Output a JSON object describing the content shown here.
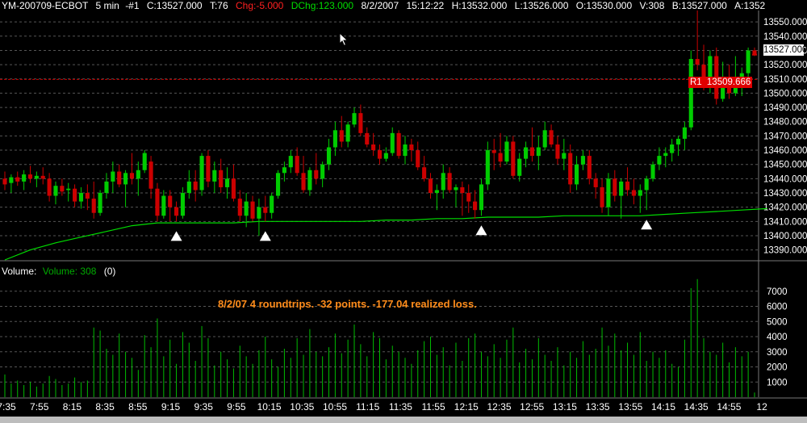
{
  "header": {
    "symbol": "YM-200709-ECBOT",
    "interval": "5 min",
    "instance": "-#1",
    "close": "C:13527.000",
    "ticks": "T:76",
    "chg": "Chg:-5.000",
    "dchg": "DChg:123.000",
    "date": "8/2/2007",
    "time": "15:12:22",
    "high": "H:13532.000",
    "low": "L:13526.000",
    "open": "O:13530.000",
    "volume": "V:308",
    "bid": "B:13527.000",
    "ask": "A:1352"
  },
  "volume_panel": {
    "label": "Volume:",
    "series_label": "Volume: 308",
    "count": "(0)"
  },
  "annotation": "8/2/07 4 roundtrips.  -32 points.  -177.04 realized loss.",
  "last_price_label": "13527.000",
  "r1_label": "R1",
  "r1_value": "13509.666",
  "colors": {
    "up": "#00cc00",
    "down": "#cc0000",
    "ma": "#00dd00",
    "grid": "#555555",
    "r1_line": "#cc0000",
    "text": "#ffffff",
    "annotation": "#ff8c1a"
  },
  "chart_data": {
    "type": "candlestick",
    "price_ticks": [
      13390,
      13400,
      13410,
      13420,
      13430,
      13440,
      13450,
      13460,
      13470,
      13480,
      13490,
      13500,
      13510,
      13520,
      13530,
      13540,
      13550
    ],
    "price_tick_labels": [
      "13390.000",
      "13400.000",
      "13410.000",
      "13420.000",
      "13430.000",
      "13440.000",
      "13450.000",
      "13460.000",
      "13470.000",
      "13480.000",
      "13490.000",
      "13500.000",
      "13510.000",
      "13520.000",
      "13530.000",
      "13540.000",
      "13550.000"
    ],
    "price_range": [
      13383,
      13558
    ],
    "volume_ticks": [
      1000,
      2000,
      3000,
      4000,
      5000,
      6000,
      7000
    ],
    "volume_tick_labels": [
      "1000",
      "2000",
      "3000",
      "4000",
      "5000",
      "6000",
      "7000"
    ],
    "volume_range": [
      0,
      8000
    ],
    "time_labels": [
      "7:35",
      "7:55",
      "8:15",
      "8:35",
      "8:55",
      "9:15",
      "9:35",
      "9:55",
      "10:15",
      "10:35",
      "10:55",
      "11:15",
      "11:35",
      "11:55",
      "12:15",
      "12:35",
      "12:55",
      "13:15",
      "13:35",
      "13:55",
      "14:15",
      "14:35",
      "14:55",
      "12"
    ],
    "r1_level": 13509.666,
    "moving_average": [
      [
        0,
        13383
      ],
      [
        4,
        13390
      ],
      [
        8,
        13395
      ],
      [
        12,
        13399
      ],
      [
        16,
        13403
      ],
      [
        20,
        13407
      ],
      [
        24,
        13409
      ],
      [
        28,
        13409
      ],
      [
        32,
        13409
      ],
      [
        36,
        13409
      ],
      [
        40,
        13410
      ],
      [
        44,
        13410
      ],
      [
        48,
        13410
      ],
      [
        52,
        13410
      ],
      [
        56,
        13410
      ],
      [
        60,
        13411
      ],
      [
        64,
        13411
      ],
      [
        68,
        13412
      ],
      [
        72,
        13412
      ],
      [
        76,
        13413
      ],
      [
        80,
        13413
      ],
      [
        84,
        13413
      ],
      [
        88,
        13414
      ],
      [
        92,
        13414
      ],
      [
        96,
        13414
      ],
      [
        100,
        13414
      ],
      [
        104,
        13415
      ],
      [
        108,
        13416
      ],
      [
        112,
        13417
      ],
      [
        116,
        13418
      ],
      [
        120,
        13419
      ]
    ],
    "buy_markers": [
      27,
      41,
      75,
      101
    ],
    "bars": [
      [
        13440,
        13445,
        13432,
        13436,
        1500
      ],
      [
        13437,
        13443,
        13430,
        13441,
        900
      ],
      [
        13441,
        13445,
        13435,
        13438,
        1100
      ],
      [
        13438,
        13446,
        13432,
        13443,
        800
      ],
      [
        13443,
        13449,
        13437,
        13440,
        1000
      ],
      [
        13440,
        13445,
        13434,
        13442,
        700
      ],
      [
        13442,
        13448,
        13436,
        13440,
        900
      ],
      [
        13440,
        13444,
        13424,
        13428,
        1400
      ],
      [
        13428,
        13438,
        13422,
        13435,
        1200
      ],
      [
        13435,
        13440,
        13428,
        13431,
        800
      ],
      [
        13432,
        13437,
        13424,
        13433,
        900
      ],
      [
        13433,
        13436,
        13420,
        13424,
        1300
      ],
      [
        13424,
        13434,
        13419,
        13430,
        1000
      ],
      [
        13430,
        13436,
        13418,
        13426,
        1100
      ],
      [
        13426,
        13438,
        13412,
        13416,
        4600
      ],
      [
        13416,
        13432,
        13414,
        13430,
        4400
      ],
      [
        13430,
        13444,
        13426,
        13438,
        3200
      ],
      [
        13438,
        13452,
        13430,
        13445,
        2800
      ],
      [
        13445,
        13450,
        13434,
        13436,
        4200
      ],
      [
        13436,
        13446,
        13420,
        13444,
        3000
      ],
      [
        13444,
        13458,
        13436,
        13440,
        2600
      ],
      [
        13440,
        13452,
        13428,
        13446,
        1800
      ],
      [
        13446,
        13460,
        13444,
        13458,
        4100
      ],
      [
        13452,
        13456,
        13426,
        13433,
        3300
      ],
      [
        13433,
        13437,
        13410,
        13414,
        5200
      ],
      [
        13414,
        13432,
        13412,
        13428,
        2700
      ],
      [
        13428,
        13432,
        13410,
        13420,
        3800
      ],
      [
        13420,
        13424,
        13410,
        13414,
        2200
      ],
      [
        13414,
        13434,
        13412,
        13430,
        4300
      ],
      [
        13430,
        13446,
        13426,
        13438,
        3600
      ],
      [
        13438,
        13446,
        13424,
        13432,
        2400
      ],
      [
        13432,
        13458,
        13428,
        13456,
        4700
      ],
      [
        13456,
        13460,
        13434,
        13438,
        3900
      ],
      [
        13438,
        13452,
        13430,
        13446,
        2100
      ],
      [
        13446,
        13454,
        13430,
        13434,
        3000
      ],
      [
        13434,
        13448,
        13426,
        13440,
        2500
      ],
      [
        13440,
        13450,
        13424,
        13426,
        1900
      ],
      [
        13426,
        13432,
        13410,
        13414,
        3400
      ],
      [
        13414,
        13430,
        13406,
        13424,
        2700
      ],
      [
        13424,
        13428,
        13410,
        13412,
        2200
      ],
      [
        13412,
        13426,
        13400,
        13420,
        3100
      ],
      [
        13420,
        13428,
        13410,
        13416,
        4000
      ],
      [
        13416,
        13430,
        13412,
        13428,
        2500
      ],
      [
        13428,
        13446,
        13426,
        13444,
        2000
      ],
      [
        13444,
        13452,
        13438,
        13448,
        3200
      ],
      [
        13448,
        13460,
        13444,
        13456,
        2600
      ],
      [
        13456,
        13462,
        13442,
        13444,
        3900
      ],
      [
        13444,
        13456,
        13430,
        13432,
        2800
      ],
      [
        13432,
        13448,
        13428,
        13446,
        4500
      ],
      [
        13446,
        13458,
        13436,
        13440,
        3000
      ],
      [
        13440,
        13452,
        13434,
        13450,
        2700
      ],
      [
        13450,
        13468,
        13446,
        13462,
        3300
      ],
      [
        13462,
        13480,
        13456,
        13474,
        4200
      ],
      [
        13474,
        13484,
        13462,
        13466,
        2900
      ],
      [
        13466,
        13480,
        13462,
        13478,
        3800
      ],
      [
        13478,
        13490,
        13476,
        13486,
        4800
      ],
      [
        13486,
        13492,
        13470,
        13472,
        3500
      ],
      [
        13472,
        13476,
        13462,
        13464,
        2700
      ],
      [
        13464,
        13472,
        13456,
        13460,
        4300
      ],
      [
        13460,
        13464,
        13450,
        13454,
        3900
      ],
      [
        13454,
        13462,
        13452,
        13458,
        2500
      ],
      [
        13458,
        13476,
        13456,
        13472,
        3400
      ],
      [
        13472,
        13474,
        13454,
        13456,
        3000
      ],
      [
        13456,
        13470,
        13450,
        13464,
        2600
      ],
      [
        13464,
        13468,
        13452,
        13460,
        2200
      ],
      [
        13460,
        13466,
        13446,
        13448,
        3100
      ],
      [
        13448,
        13456,
        13438,
        13440,
        3700
      ],
      [
        13440,
        13444,
        13426,
        13430,
        4000
      ],
      [
        13430,
        13436,
        13418,
        13432,
        2800
      ],
      [
        13432,
        13450,
        13426,
        13444,
        3300
      ],
      [
        13444,
        13448,
        13430,
        13432,
        2100
      ],
      [
        13432,
        13436,
        13420,
        13434,
        3600
      ],
      [
        13434,
        13438,
        13414,
        13430,
        2400
      ],
      [
        13430,
        13436,
        13416,
        13424,
        3900
      ],
      [
        13424,
        13432,
        13412,
        13418,
        4200
      ],
      [
        13418,
        13440,
        13414,
        13436,
        3000
      ],
      [
        13436,
        13466,
        13432,
        13460,
        2700
      ],
      [
        13460,
        13468,
        13446,
        13458,
        3500
      ],
      [
        13458,
        13472,
        13448,
        13452,
        2600
      ],
      [
        13452,
        13470,
        13450,
        13466,
        3800
      ],
      [
        13466,
        13470,
        13440,
        13442,
        4600
      ],
      [
        13442,
        13458,
        13438,
        13454,
        2300
      ],
      [
        13454,
        13466,
        13448,
        13462,
        3200
      ],
      [
        13462,
        13476,
        13452,
        13456,
        2500
      ],
      [
        13456,
        13470,
        13446,
        13462,
        3900
      ],
      [
        13462,
        13480,
        13460,
        13474,
        2800
      ],
      [
        13474,
        13478,
        13462,
        13464,
        2400
      ],
      [
        13464,
        13470,
        13450,
        13454,
        3300
      ],
      [
        13454,
        13468,
        13446,
        13458,
        2100
      ],
      [
        13458,
        13464,
        13430,
        13436,
        3000
      ],
      [
        13436,
        13456,
        13432,
        13450,
        2600
      ],
      [
        13450,
        13460,
        13446,
        13456,
        3700
      ],
      [
        13456,
        13460,
        13436,
        13440,
        2800
      ],
      [
        13440,
        13444,
        13426,
        13434,
        3200
      ],
      [
        13434,
        13440,
        13416,
        13420,
        4600
      ],
      [
        13420,
        13444,
        13414,
        13440,
        3400
      ],
      [
        13440,
        13446,
        13424,
        13428,
        4200
      ],
      [
        13428,
        13440,
        13412,
        13438,
        3100
      ],
      [
        13438,
        13448,
        13428,
        13432,
        3600
      ],
      [
        13432,
        13440,
        13422,
        13428,
        2800
      ],
      [
        13428,
        13436,
        13416,
        13432,
        4300
      ],
      [
        13432,
        13442,
        13418,
        13440,
        2400
      ],
      [
        13440,
        13452,
        13438,
        13450,
        3000
      ],
      [
        13450,
        13462,
        13446,
        13456,
        2600
      ],
      [
        13456,
        13462,
        13448,
        13458,
        3100
      ],
      [
        13458,
        13468,
        13452,
        13464,
        2200
      ],
      [
        13464,
        13470,
        13456,
        13468,
        2000
      ],
      [
        13468,
        13480,
        13460,
        13476,
        3800
      ],
      [
        13476,
        13530,
        13474,
        13524,
        7200
      ],
      [
        13524,
        13558,
        13516,
        13520,
        7800
      ],
      [
        13520,
        13534,
        13502,
        13506,
        3900
      ],
      [
        13506,
        13530,
        13500,
        13526,
        3000
      ],
      [
        13526,
        13532,
        13492,
        13496,
        2800
      ],
      [
        13496,
        13522,
        13494,
        13510,
        3600
      ],
      [
        13510,
        13520,
        13496,
        13500,
        2300
      ],
      [
        13500,
        13526,
        13498,
        13504,
        3300
      ],
      [
        13504,
        13518,
        13498,
        13514,
        2700
      ],
      [
        13514,
        13532,
        13510,
        13530,
        3000
      ],
      [
        13530,
        13532,
        13526,
        13527,
        308
      ]
    ]
  }
}
